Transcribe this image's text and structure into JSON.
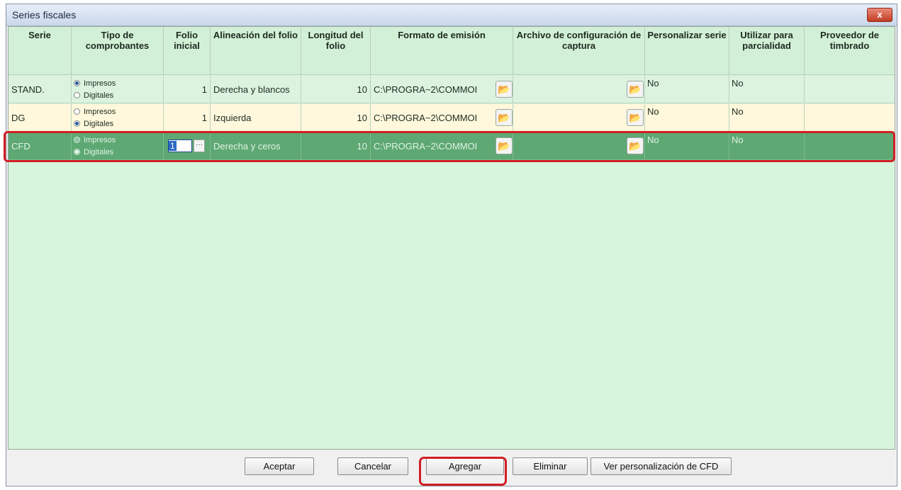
{
  "window": {
    "title": "Series fiscales",
    "close_label": "x"
  },
  "columns": [
    "Serie",
    "Tipo de comprobantes",
    "Folio inicial",
    "Alineación del folio",
    "Longitud del folio",
    "Formato de emisión",
    "Archivo de configuración de captura",
    "Personalizar serie",
    "Utilizar para parcialidad",
    "Proveedor de timbrado"
  ],
  "radio_options": [
    "Impresos",
    "Digitales"
  ],
  "rows": [
    {
      "serie": "STAND.",
      "tipo_selected": "Impresos",
      "folio_inicial": "1",
      "alineacion": "Derecha y blancos",
      "longitud": "10",
      "formato": "C:\\PROGRA~2\\COMMOI",
      "archivo": "",
      "personalizar": "No",
      "parcialidad": "No",
      "proveedor": ""
    },
    {
      "serie": "DG",
      "tipo_selected": "Digitales",
      "folio_inicial": "1",
      "alineacion": "Izquierda",
      "longitud": "10",
      "formato": "C:\\PROGRA~2\\COMMOI",
      "archivo": "",
      "personalizar": "No",
      "parcialidad": "No",
      "proveedor": ""
    },
    {
      "serie": "CFD",
      "tipo_selected": "Digitales",
      "folio_inicial": "1",
      "alineacion": "Derecha y ceros",
      "longitud": "10",
      "formato": "C:\\PROGRA~2\\COMMOI",
      "archivo": "",
      "personalizar": "No",
      "parcialidad": "No",
      "proveedor": "",
      "selected": true
    }
  ],
  "buttons": {
    "aceptar": "Aceptar",
    "cancelar": "Cancelar",
    "agregar": "Agregar",
    "eliminar": "Eliminar",
    "ver_personalizacion": "Ver personalización de CFD"
  },
  "colors": {
    "grid_background": "#d7f5dc",
    "row_alt": "#fff8dc",
    "selected_row": "#5ea874",
    "highlight": "#d21f24"
  },
  "icons": {
    "folder": "folder-open-icon",
    "ellipsis": "ellipsis-icon"
  }
}
